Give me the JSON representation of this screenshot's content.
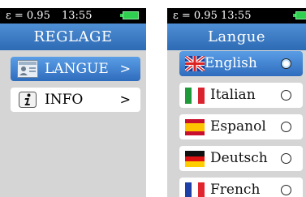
{
  "left_screen": {
    "status": {
      "emissivity": "ε = 0.95",
      "time": "13:55"
    },
    "title": "REGLAGE",
    "menu": [
      {
        "label": "LANGUE",
        "chevron": ">",
        "icon": "person-card-icon",
        "selected": true
      },
      {
        "label": "INFO",
        "chevron": ">",
        "icon": "info-icon",
        "selected": false
      }
    ]
  },
  "right_screen": {
    "status": {
      "emissivity": "ε = 0.95",
      "time": "13:55"
    },
    "title": "Langue",
    "languages": [
      {
        "label": "English",
        "icon": "uk-flag-icon",
        "selected": true
      },
      {
        "label": "Italian",
        "icon": "italy-flag-icon",
        "selected": false
      },
      {
        "label": "Espanol",
        "icon": "spain-flag-icon",
        "selected": false
      },
      {
        "label": "Deutsch",
        "icon": "germany-flag-icon",
        "selected": false
      },
      {
        "label": "French",
        "icon": "france-flag-icon",
        "selected": false
      }
    ]
  },
  "colors": {
    "title_bar": "#3a7bc8",
    "selected_item": "#3f80cf",
    "battery": "#2fd050",
    "screen_bg": "#d5d5d5"
  }
}
